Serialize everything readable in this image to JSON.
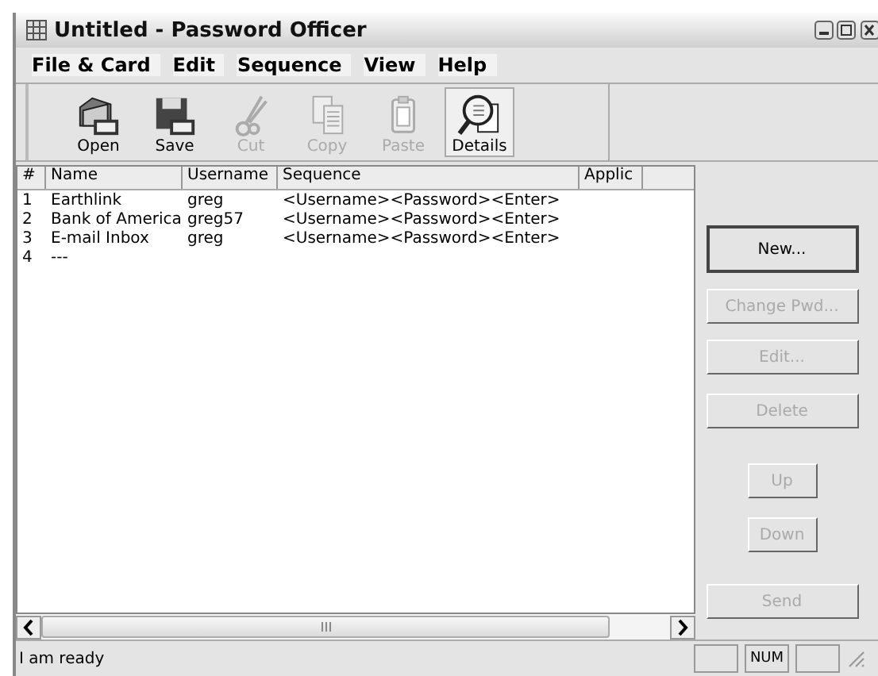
{
  "window": {
    "title": "Untitled - Password Officer"
  },
  "menu": [
    "File & Card",
    "Edit",
    "Sequence",
    "View",
    "Help"
  ],
  "toolbar": [
    {
      "label": "Open",
      "kind": "open",
      "disabled": false,
      "selected": false
    },
    {
      "label": "Save",
      "kind": "save",
      "disabled": false,
      "selected": false
    },
    {
      "label": "Cut",
      "kind": "cut",
      "disabled": true,
      "selected": false
    },
    {
      "label": "Copy",
      "kind": "copy",
      "disabled": true,
      "selected": false
    },
    {
      "label": "Paste",
      "kind": "paste",
      "disabled": true,
      "selected": false
    },
    {
      "label": "Details",
      "kind": "details",
      "disabled": false,
      "selected": true
    }
  ],
  "table": {
    "columns": [
      "#",
      "Name",
      "Username",
      "Sequence",
      "Applic"
    ],
    "rows": [
      {
        "cells": [
          "1",
          "Earthlink",
          "greg",
          "<Username><Password><Enter>"
        ]
      },
      {
        "cells": [
          "2",
          "Bank of America",
          "greg57",
          "<Username><Password><Enter>"
        ]
      },
      {
        "cells": [
          "3",
          "E-mail Inbox",
          "greg",
          "<Username><Password><Enter>"
        ]
      },
      {
        "cells": [
          "4",
          "---"
        ]
      }
    ]
  },
  "buttons": [
    {
      "label": "New...",
      "disabled": false,
      "kind": "wide"
    },
    {
      "label": "Change Pwd...",
      "disabled": true,
      "kind": "wide"
    },
    {
      "label": "Edit...",
      "disabled": true,
      "kind": "wide"
    },
    {
      "label": "Delete",
      "disabled": true,
      "kind": "wide"
    },
    {
      "label": "Up",
      "disabled": true,
      "kind": "narrow"
    },
    {
      "label": "Down",
      "disabled": true,
      "kind": "narrow"
    },
    {
      "label": "Send",
      "disabled": true,
      "kind": "wide"
    }
  ],
  "status_bar": {
    "message": "I am ready",
    "panes": [
      "NUM"
    ]
  }
}
